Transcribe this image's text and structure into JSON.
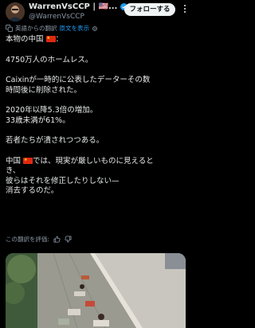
{
  "author": {
    "display_name": "WarrenVsCCP | 🇺🇸...",
    "handle": "@WarrenVsCCP"
  },
  "follow_button_label": "フォローする",
  "translation": {
    "source_text": "英語からの翻訳",
    "show_original": "原文を表示"
  },
  "tweet": {
    "line1": "本物の中国",
    "line2": "4750万人のホームレス。",
    "line3": "Caixinが一時的に公表したデーターその数",
    "line4": "時間後に削除された。",
    "line5": "2020年以降5.3倍の増加。",
    "line6": "33歳未満が61%。",
    "line7": "若者たちが潰されつつある。",
    "line8_pre": "中国",
    "line8_post": "では、現実が厳しいものに見えると",
    "line8_tail": "き、",
    "line9": "彼らはそれを修正したりしない—",
    "line10": "消去するのだ。"
  },
  "rate_translation": "この翻訳を評価:",
  "colors": {
    "background": "#000000",
    "text": "#e7e9ea",
    "muted": "#8b98a5",
    "link": "#1d9bf0",
    "verified": "#1d9bf0",
    "flag_red": "#de2910"
  },
  "icons": {
    "verified": "verified-badge-icon",
    "more": "more-icon",
    "translate": "translate-icon",
    "thumbs_up": "thumbs-up-icon",
    "thumbs_down": "thumbs-down-icon",
    "flag": "china-flag-icon"
  }
}
